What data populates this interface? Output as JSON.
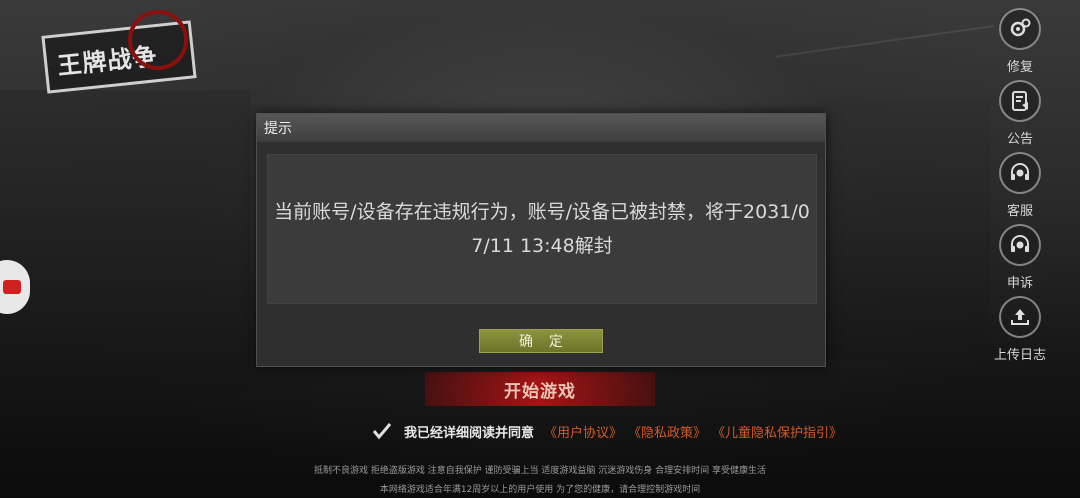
{
  "logo": {
    "text": "王牌战争"
  },
  "right_menu": [
    {
      "label": "修复",
      "icon": "gear-icon"
    },
    {
      "label": "公告",
      "icon": "notice-icon"
    },
    {
      "label": "客服",
      "icon": "headset-icon"
    },
    {
      "label": "申诉",
      "icon": "appeal-headset-icon"
    },
    {
      "label": "上传日志",
      "icon": "upload-icon"
    }
  ],
  "dialog": {
    "title": "提示",
    "message": "当前账号/设备存在违规行为，账号/设备已被封禁，将于2031/07/11 13:48解封",
    "confirm_label": "确 定"
  },
  "start_button": {
    "label": "开始游戏"
  },
  "agreement": {
    "text": "我已经详细阅读并同意",
    "links": [
      "《用户协议》",
      "《隐私政策》",
      "《儿童隐私保护指引》"
    ]
  },
  "footer": {
    "line1": "抵制不良游戏 拒绝盗版游戏 注意自我保护 谨防受骗上当 适度游戏益脑 沉迷游戏伤身 合理安排时间 享受健康生活",
    "line2": "本网络游戏适合年满12周岁以上的用户使用    为了您的健康，请合理控制游戏时间"
  },
  "colors": {
    "confirm_button": "#7b8434",
    "link": "#d35a2a",
    "start_button": "#b41414"
  }
}
